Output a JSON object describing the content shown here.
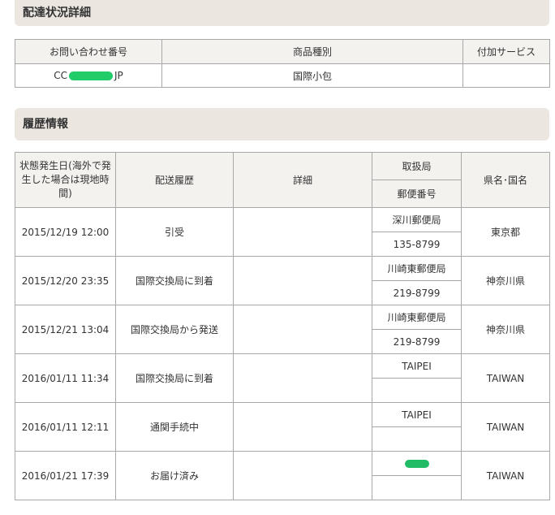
{
  "delivery_status": {
    "title": "配達状況詳細",
    "headers": [
      "お問い合わせ番号",
      "商品種別",
      "付加サービス"
    ],
    "tracking_prefix": "CC",
    "tracking_suffix": "JP",
    "product_type": "国際小包",
    "additional_service": ""
  },
  "history": {
    "title": "履歴情報",
    "headers": {
      "status_date": "状態発生日(海外で発生した場合は現地時間)",
      "delivery_history": "配送履歴",
      "details": "詳細",
      "office": "取扱局",
      "postal_code": "郵便番号",
      "region": "県名･国名"
    },
    "rows": [
      {
        "date": "2015/12/19 12:00",
        "event": "引受",
        "detail": "",
        "office": "深川郵便局",
        "postal": "135-8799",
        "region": "東京都"
      },
      {
        "date": "2015/12/20 23:35",
        "event": "国際交換局に到着",
        "detail": "",
        "office": "川崎東郵便局",
        "postal": "219-8799",
        "region": "神奈川県"
      },
      {
        "date": "2015/12/21 13:04",
        "event": "国際交換局から発送",
        "detail": "",
        "office": "川崎東郵便局",
        "postal": "219-8799",
        "region": "神奈川県"
      },
      {
        "date": "2016/01/11 11:34",
        "event": "国際交換局に到着",
        "detail": "",
        "office": "TAIPEI",
        "postal": "",
        "region": "TAIWAN"
      },
      {
        "date": "2016/01/11 12:11",
        "event": "通関手続中",
        "detail": "",
        "office": "TAIPEI",
        "postal": "",
        "region": "TAIWAN"
      },
      {
        "date": "2016/01/21 17:39",
        "event": "お届け済み",
        "detail": "",
        "office": "",
        "postal": "",
        "region": "TAIWAN"
      }
    ]
  },
  "colors": {
    "redaction": "#22cc66",
    "header_bg": "#ebe6e0",
    "border": "#a8a8a8"
  }
}
